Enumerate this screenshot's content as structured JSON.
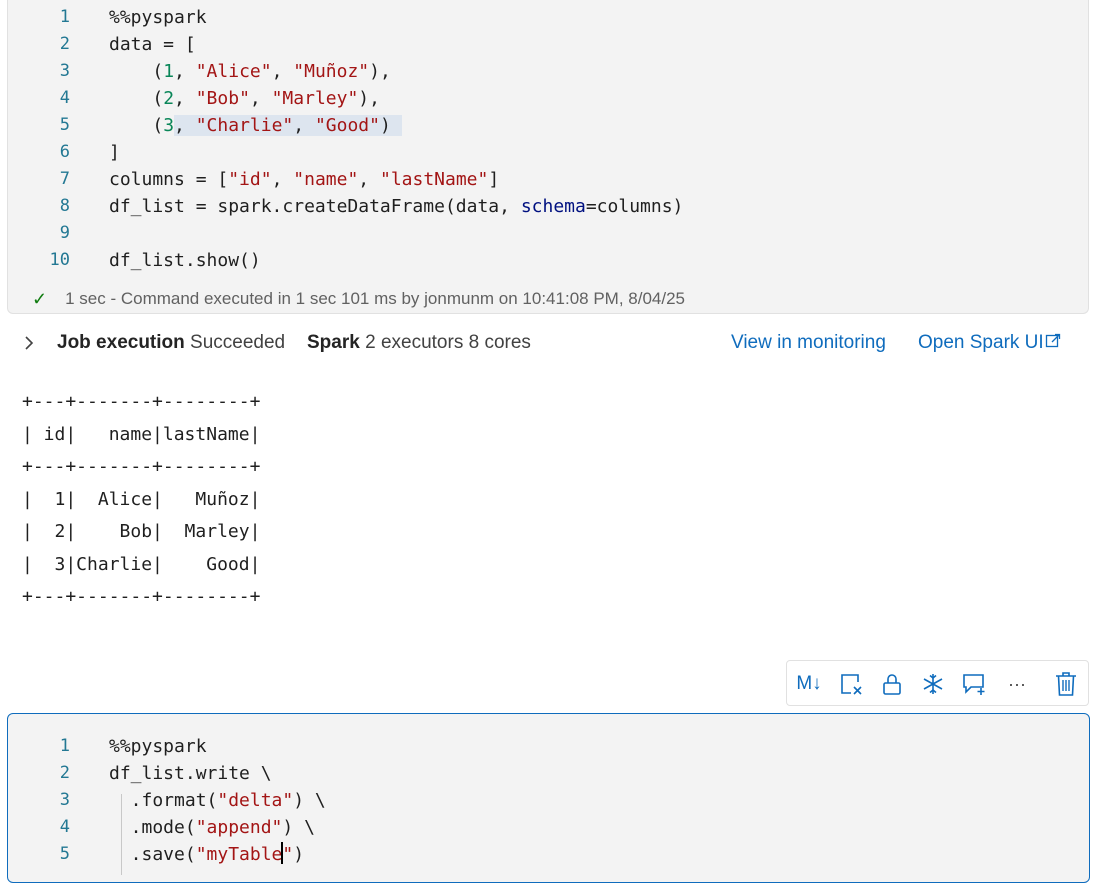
{
  "cell1": {
    "lines": [
      {
        "n": "1",
        "tokens": [
          {
            "t": "%%pyspark",
            "c": ""
          }
        ]
      },
      {
        "n": "2",
        "tokens": [
          {
            "t": "data = [",
            "c": ""
          }
        ]
      },
      {
        "n": "3",
        "tokens": [
          {
            "t": "    (",
            "c": ""
          },
          {
            "t": "1",
            "c": "num"
          },
          {
            "t": ", ",
            "c": ""
          },
          {
            "t": "\"Alice\"",
            "c": "str"
          },
          {
            "t": ", ",
            "c": ""
          },
          {
            "t": "\"Muñoz\"",
            "c": "str"
          },
          {
            "t": "),",
            "c": ""
          }
        ]
      },
      {
        "n": "4",
        "tokens": [
          {
            "t": "    (",
            "c": ""
          },
          {
            "t": "2",
            "c": "num"
          },
          {
            "t": ", ",
            "c": ""
          },
          {
            "t": "\"Bob\"",
            "c": "str"
          },
          {
            "t": ", ",
            "c": ""
          },
          {
            "t": "\"Marley\"",
            "c": "str"
          },
          {
            "t": "),",
            "c": ""
          }
        ]
      },
      {
        "n": "5",
        "tokens": [
          {
            "t": "    (",
            "c": ""
          },
          {
            "t": "3",
            "c": "num"
          },
          {
            "t": ", ",
            "c": "hl"
          },
          {
            "t": "\"Charlie\"",
            "c": "str hl"
          },
          {
            "t": ", ",
            "c": "hl"
          },
          {
            "t": "\"Good\"",
            "c": "str hl"
          },
          {
            "t": ") ",
            "c": "hl"
          }
        ]
      },
      {
        "n": "6",
        "tokens": [
          {
            "t": "]",
            "c": ""
          }
        ]
      },
      {
        "n": "7",
        "tokens": [
          {
            "t": "columns = [",
            "c": ""
          },
          {
            "t": "\"id\"",
            "c": "str"
          },
          {
            "t": ", ",
            "c": ""
          },
          {
            "t": "\"name\"",
            "c": "str"
          },
          {
            "t": ", ",
            "c": ""
          },
          {
            "t": "\"lastName\"",
            "c": "str"
          },
          {
            "t": "]",
            "c": ""
          }
        ]
      },
      {
        "n": "8",
        "tokens": [
          {
            "t": "df_list = spark.createDataFrame(data, ",
            "c": ""
          },
          {
            "t": "schema",
            "c": "kw"
          },
          {
            "t": "=columns)",
            "c": ""
          }
        ]
      },
      {
        "n": "9",
        "tokens": [
          {
            "t": "",
            "c": ""
          }
        ]
      },
      {
        "n": "10",
        "tokens": [
          {
            "t": "df_list.show()",
            "c": ""
          }
        ]
      }
    ],
    "status": "1 sec - Command executed in 1 sec 101 ms by jonmunm on 10:41:08 PM, 8/04/25"
  },
  "job": {
    "chevron": "›",
    "job_label": "Job execution",
    "job_value": "Succeeded",
    "spark_label": "Spark",
    "spark_value": "2 executors 8 cores",
    "monitor_link": "View in monitoring",
    "spark_ui_link": "Open Spark UI"
  },
  "output": "+---+-------+--------+\n| id|   name|lastName|\n+---+-------+--------+\n|  1|  Alice|   Muñoz|\n|  2|    Bob|  Marley|\n|  3|Charlie|    Good|\n+---+-------+--------+",
  "toolbar": {
    "icons": [
      "markdown-toggle-icon",
      "clear-output-icon",
      "lock-icon",
      "freeze-icon",
      "add-comment-icon",
      "more-icon",
      "delete-icon"
    ],
    "markdown_label": "M↓",
    "more_label": "···"
  },
  "cell2": {
    "lines": [
      {
        "n": "1",
        "tokens": [
          {
            "t": "%%pyspark",
            "c": ""
          }
        ]
      },
      {
        "n": "2",
        "tokens": [
          {
            "t": "df_list.write \\",
            "c": ""
          }
        ]
      },
      {
        "n": "3",
        "tokens": [
          {
            "t": "  .format(",
            "c": ""
          },
          {
            "t": "\"delta\"",
            "c": "str"
          },
          {
            "t": ") \\",
            "c": ""
          }
        ]
      },
      {
        "n": "4",
        "tokens": [
          {
            "t": "  .mode(",
            "c": ""
          },
          {
            "t": "\"append\"",
            "c": "str"
          },
          {
            "t": ") \\",
            "c": ""
          }
        ]
      },
      {
        "n": "5",
        "tokens": [
          {
            "t": "  .save(",
            "c": ""
          },
          {
            "t": "\"myTable",
            "c": "str"
          },
          {
            "t": "|CURSOR|",
            "c": "cursor"
          },
          {
            "t": "\"",
            "c": "str"
          },
          {
            "t": ")",
            "c": ""
          }
        ]
      }
    ]
  }
}
